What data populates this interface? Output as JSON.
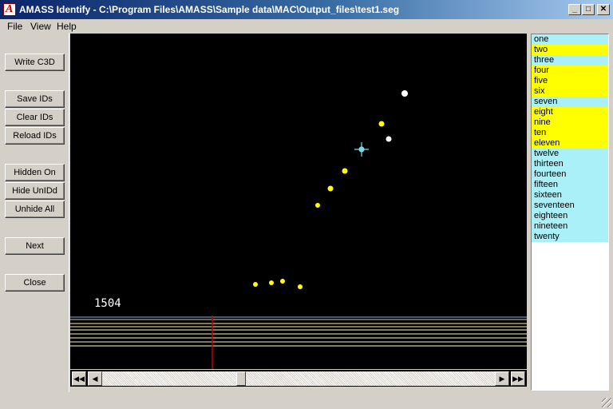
{
  "window": {
    "title": "AMASS Identify  -  C:\\Program Files\\AMASS\\Sample data\\MAC\\Output_files\\test1.seg",
    "app_icon_letter": "A",
    "min_glyph": "_",
    "max_glyph": "□",
    "close_glyph": "✕"
  },
  "menu": {
    "file": "File",
    "view": "View",
    "help": "Help"
  },
  "buttons": {
    "write_c3d": "Write C3D",
    "save_ids": "Save IDs",
    "clear_ids": "Clear IDs",
    "reload_ids": "Reload IDs",
    "hidden_on": "Hidden On",
    "hide_unidd": "Hide UnIDd",
    "unhide_all": "Unhide All",
    "next": "Next",
    "close": "Close"
  },
  "canvas": {
    "frame_number": "1504",
    "background": "#000000",
    "marker_color_identified": "#ffff00",
    "marker_color_unidentified": "#ffffff",
    "cursor_color": "#7fd6e8"
  },
  "scrollbar": {
    "first_glyph": "◀◀",
    "prev_glyph": "◀",
    "next_glyph": "▶",
    "last_glyph": "▶▶",
    "position": 0.35
  },
  "labels": [
    {
      "name": "one",
      "color": "#aaf0f8"
    },
    {
      "name": "two",
      "color": "#ffff00"
    },
    {
      "name": "three",
      "color": "#aaf0f8"
    },
    {
      "name": "four",
      "color": "#ffff00"
    },
    {
      "name": "five",
      "color": "#ffff00"
    },
    {
      "name": "six",
      "color": "#ffff00"
    },
    {
      "name": "seven",
      "color": "#aaf0f8"
    },
    {
      "name": "eight",
      "color": "#ffff00"
    },
    {
      "name": "nine",
      "color": "#ffff00"
    },
    {
      "name": "ten",
      "color": "#ffff00"
    },
    {
      "name": "eleven",
      "color": "#ffff00"
    },
    {
      "name": "twelve",
      "color": "#aaf0f8"
    },
    {
      "name": "thirteen",
      "color": "#aaf0f8"
    },
    {
      "name": "fourteen",
      "color": "#aaf0f8"
    },
    {
      "name": "fifteen",
      "color": "#aaf0f8"
    },
    {
      "name": "sixteen",
      "color": "#aaf0f8"
    },
    {
      "name": "seventeen",
      "color": "#aaf0f8"
    },
    {
      "name": "eighteen",
      "color": "#aaf0f8"
    },
    {
      "name": "nineteen",
      "color": "#aaf0f8"
    },
    {
      "name": "twenty",
      "color": "#aaf0f8"
    }
  ]
}
